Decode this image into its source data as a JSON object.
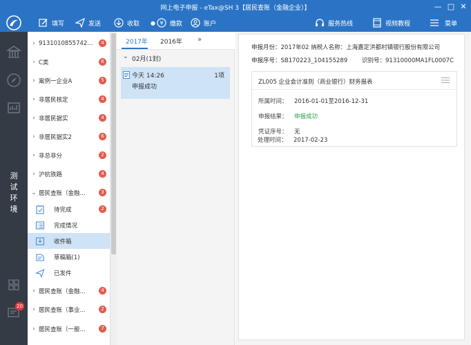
{
  "window": {
    "title": "网上电子申报 - eTax@SH 3【居民查账（金融企业）】",
    "controls": [
      "—",
      "□",
      "✕"
    ]
  },
  "toolbar": {
    "items": [
      {
        "label": "填写",
        "icon": "edit-icon"
      },
      {
        "label": "发送",
        "icon": "send-icon"
      },
      {
        "label": "收取",
        "icon": "receive-icon"
      },
      {
        "label": "缴款",
        "icon": "payment-icon"
      },
      {
        "label": "账户",
        "icon": "account-icon"
      }
    ],
    "right_items": [
      {
        "label": "服务热线",
        "icon": "headset-icon"
      },
      {
        "label": "视频教程",
        "icon": "video-icon"
      },
      {
        "label": "菜单",
        "icon": "menu-icon"
      }
    ]
  },
  "rail": {
    "env_text": [
      "测",
      "试",
      "环",
      "境"
    ],
    "badge": "20"
  },
  "nav": {
    "items": [
      {
        "label": "9131010855742...",
        "badge": "4",
        "expanded": false
      },
      {
        "label": "C类",
        "badge": "6",
        "expanded": false
      },
      {
        "label": "案例一企业A",
        "badge": "5",
        "expanded": false
      },
      {
        "label": "非居民核定",
        "badge": "4",
        "expanded": false
      },
      {
        "label": "非居民据实",
        "badge": "4",
        "expanded": false
      },
      {
        "label": "非居民据实2",
        "badge": "6",
        "expanded": false
      },
      {
        "label": "非总非分",
        "badge": "2",
        "expanded": false
      },
      {
        "label": "沪杭铁路",
        "badge": "4",
        "expanded": false
      },
      {
        "label": "居民查账（金融...",
        "badge": "3",
        "expanded": true
      }
    ],
    "sub_items": [
      {
        "label": "待完成",
        "badge": "2",
        "icon": "pending-icon",
        "active": false
      },
      {
        "label": "完成情况",
        "badge": "",
        "icon": "list-icon",
        "active": false
      },
      {
        "label": "收件箱",
        "badge": "",
        "icon": "inbox-icon",
        "active": true
      },
      {
        "label": "草稿箱(1)",
        "badge": "",
        "icon": "draft-icon",
        "active": false
      },
      {
        "label": "已发件",
        "badge": "",
        "icon": "sent-icon",
        "active": false
      }
    ],
    "more_items": [
      {
        "label": "居民查账（金融...",
        "badge": "4"
      },
      {
        "label": "居民查账（事业...",
        "badge": "2"
      },
      {
        "label": "居民查账（一般...",
        "badge": "7"
      }
    ]
  },
  "list": {
    "tabs": [
      "2017年",
      "2016年"
    ],
    "more": "»",
    "month": "02月(1封)",
    "record": {
      "time": "今天 14:26",
      "count": "1项",
      "status": "申报成功"
    }
  },
  "detail": {
    "line1": "申报月份：2017年02 纳税人名称：上海嘉定洪都村镇银行股份有限公司",
    "line2_a": "申报序号：SB170223_104155289",
    "line2_b": "识别号：91310000MA1FL0007C",
    "report": {
      "title": "ZL005 企业会计准则（商业银行）财务报表",
      "fields": [
        {
          "key": "所属时间：",
          "value": "2016-01-01至2016-12-31",
          "green": false
        },
        {
          "key": "申报结果：",
          "value": "申报成功",
          "green": true
        },
        {
          "key": "凭证序号：",
          "value": "无",
          "green": false
        },
        {
          "key": "处理时间：",
          "value": "2017-02-23",
          "green": false
        }
      ]
    }
  },
  "colors": {
    "primary": "#2b74c5",
    "rail": "#343b45",
    "badge": "#e45b4c",
    "selected": "#cfe3f7",
    "success": "#2ea14a"
  }
}
